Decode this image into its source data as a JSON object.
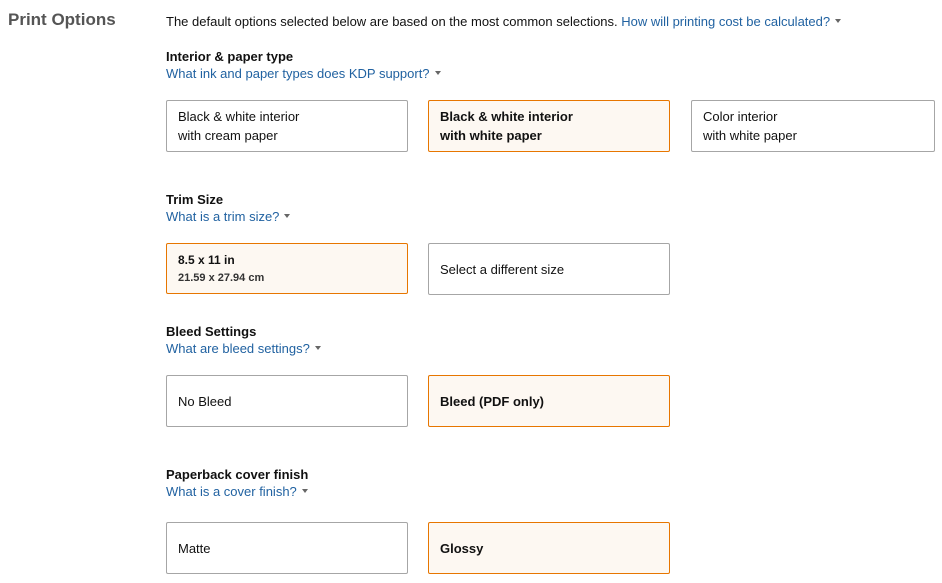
{
  "page": {
    "title": "Print Options",
    "intro_text": "The default options selected below are based on the most common selections.",
    "intro_link": "How will printing cost be calculated?"
  },
  "interior": {
    "title": "Interior & paper type",
    "help": "What ink and paper types does KDP support?",
    "options": [
      {
        "line1": "Black & white interior",
        "line2": "with cream paper",
        "selected": false
      },
      {
        "line1": "Black & white interior",
        "line2": "with white paper",
        "selected": true
      },
      {
        "line1": "Color interior",
        "line2": "with white paper",
        "selected": false
      }
    ]
  },
  "trim": {
    "title": "Trim Size",
    "help": "What is a trim size?",
    "options": [
      {
        "line1": "8.5 x 11 in",
        "line2": "21.59 x 27.94 cm",
        "selected": true
      },
      {
        "line1": "Select a different size",
        "selected": false
      }
    ]
  },
  "bleed": {
    "title": "Bleed Settings",
    "help": "What are bleed settings?",
    "options": [
      {
        "line1": "No Bleed",
        "selected": false
      },
      {
        "line1": "Bleed (PDF only)",
        "selected": true
      }
    ]
  },
  "cover": {
    "title": "Paperback cover finish",
    "help": "What is a cover finish?",
    "options": [
      {
        "line1": "Matte",
        "selected": false
      },
      {
        "line1": "Glossy",
        "selected": true
      }
    ]
  },
  "colors": {
    "link": "#2162a1",
    "selected_border": "#e77600",
    "selected_bg": "#fdf8f2",
    "default_border": "#a6a6a6"
  }
}
